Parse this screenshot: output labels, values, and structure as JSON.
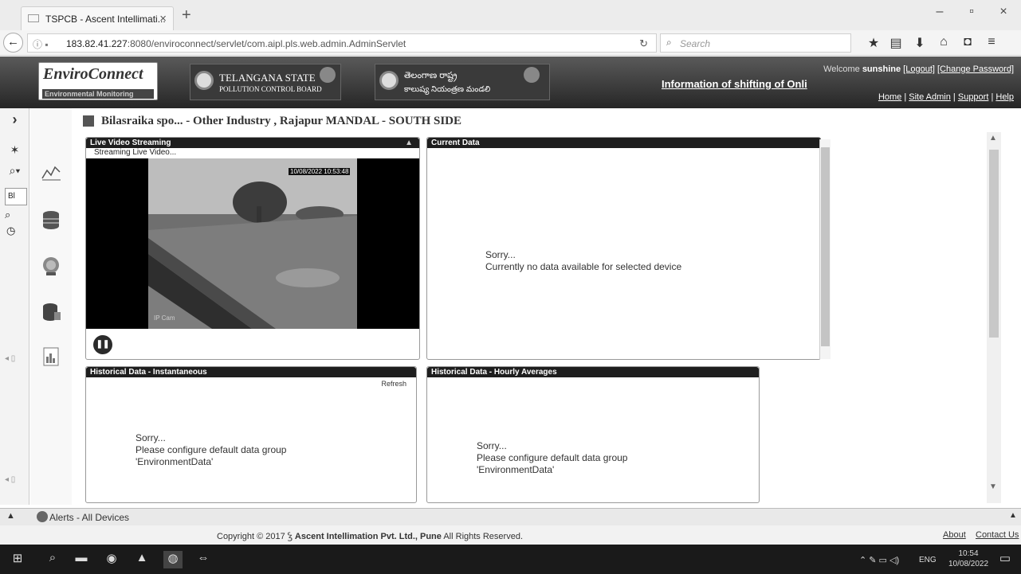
{
  "browser": {
    "tab_title": "TSPCB - Ascent Intellimati...",
    "tab_close": "×",
    "new_tab": "+",
    "url_host": "183.82.41.227",
    "url_rest": ":8080/enviroconnect/servlet/com.aipl.pls.web.admin.AdminServlet",
    "search_placeholder": "Search",
    "window_buttons": [
      "–",
      "▫",
      "×"
    ]
  },
  "header": {
    "logo_title": "EnviroConnect",
    "logo_subtitle": "Environmental Monitoring",
    "board1_line1": "TELANGANA STATE",
    "board1_line2": "POLLUTION CONTROL BOARD",
    "board2_line1": "తెలంగాణ రాష్ట్ర",
    "board2_line2": "కాలుష్య నియంత్రణ మండలి",
    "marquee": "Information of shifting of Onli",
    "welcome": "Welcome",
    "user": "sunshine",
    "logout": "[Logout]",
    "change_password": "[Change Password]",
    "links": [
      "Home",
      "Site Admin",
      "Support",
      "Help"
    ],
    "sep": " | "
  },
  "page": {
    "title": "Bilasraika spo... - Other Industry , Rajapur MANDAL - SOUTH SIDE"
  },
  "leftbar": {
    "expand": "›",
    "search_text": "Bl"
  },
  "panels": {
    "video": {
      "title": "Live Video Streaming",
      "status": "Streaming Live Video...",
      "timestamp": "10/08/2022 10:53:48",
      "watermark": "IP Cam"
    },
    "current": {
      "title": "Current Data",
      "sorry": "Sorry...",
      "message": "Currently no data available for selected device"
    },
    "instantaneous": {
      "title": "Historical Data - Instantaneous",
      "refresh": "Refresh",
      "sorry": "Sorry...",
      "message": "Please configure default data group",
      "group": "'EnvironmentData'"
    },
    "hourly": {
      "title": "Historical Data - Hourly Averages",
      "sorry": "Sorry...",
      "message": "Please configure default data group",
      "group": "'EnvironmentData'"
    }
  },
  "footer": {
    "alerts": "Alerts - All Devices",
    "copyright": "Copyright © 2017",
    "company": "Ascent Intellimation Pvt. Ltd., Pune",
    "rights": "All Rights Reserved.",
    "about": "About",
    "contact": "Contact Us"
  },
  "taskbar": {
    "language": "ENG",
    "time": "10:54",
    "date": "10/08/2022"
  },
  "colors": {
    "header_dark": "#262626",
    "panel_head": "#1e1e1e"
  }
}
